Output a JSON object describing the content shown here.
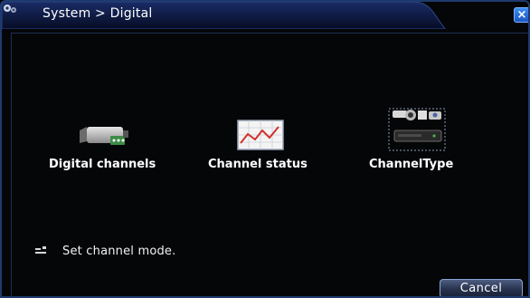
{
  "window": {
    "breadcrumb": "System > Digital",
    "close_label": "×"
  },
  "options": [
    {
      "label": "Digital channels",
      "icon": "ip-camera-icon"
    },
    {
      "label": "Channel status",
      "icon": "line-graph-icon"
    },
    {
      "label": "ChannelType",
      "icon": "camera-and-dvr-icon"
    }
  ],
  "hint": {
    "text": "Set channel mode.",
    "icon": "info-icon"
  },
  "footer": {
    "cancel_label": "Cancel"
  },
  "colors": {
    "frame_border": "#1f3a6e",
    "title_tab": "#0b1a4a",
    "button_blue": "#1c56c4"
  }
}
